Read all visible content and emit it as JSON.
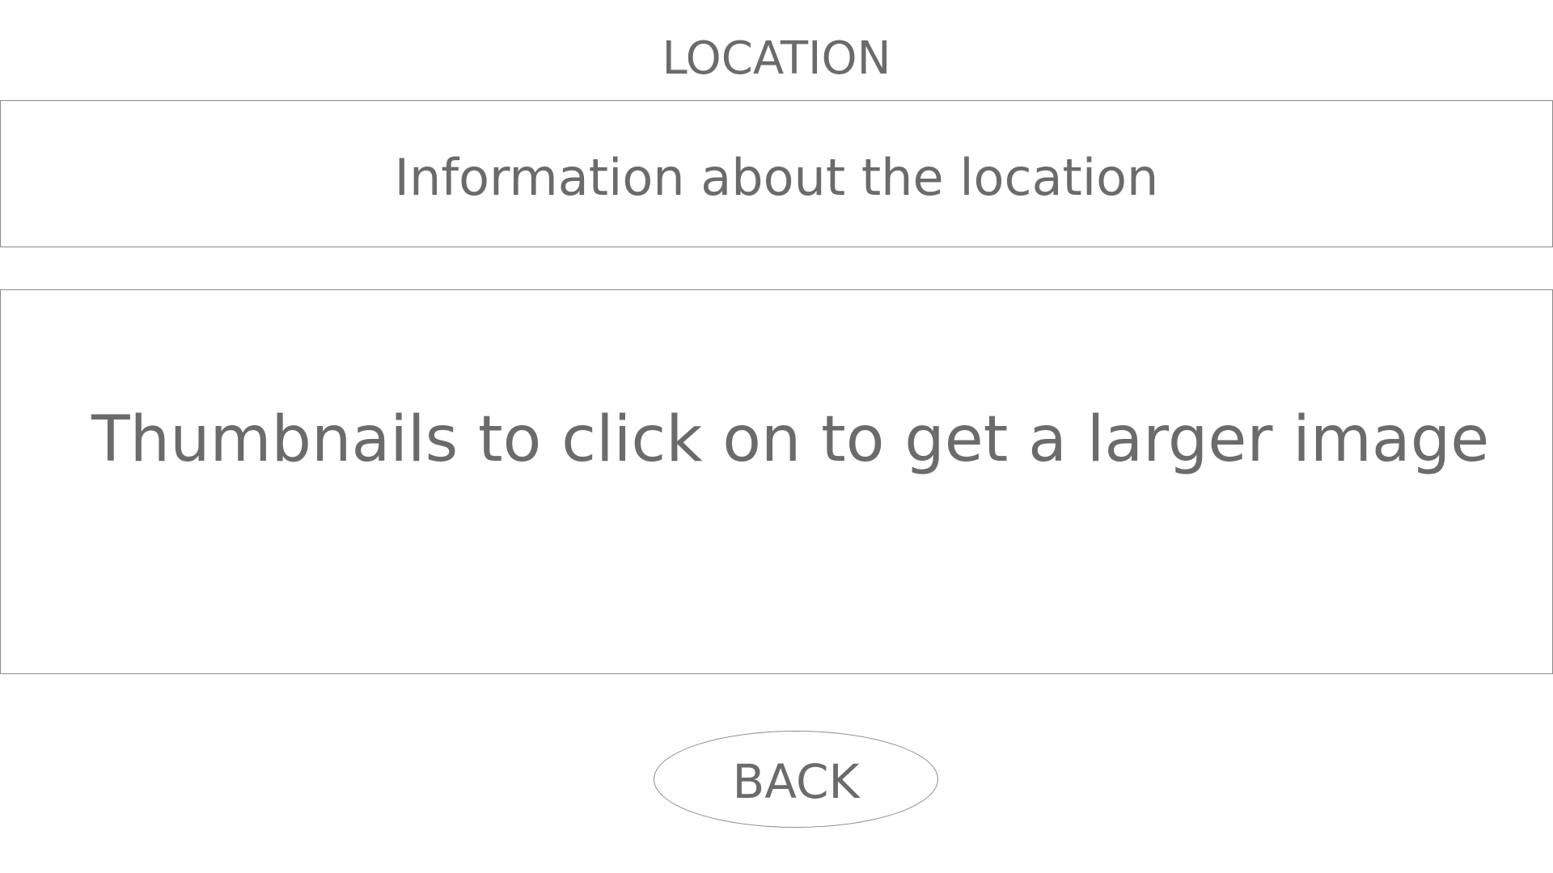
{
  "header": {
    "title": "LOCATION"
  },
  "info_panel": {
    "text": "Information about the location"
  },
  "thumbnail_panel": {
    "text": "Thumbnails to click on to get a larger image"
  },
  "footer": {
    "back_label": "BACK"
  }
}
